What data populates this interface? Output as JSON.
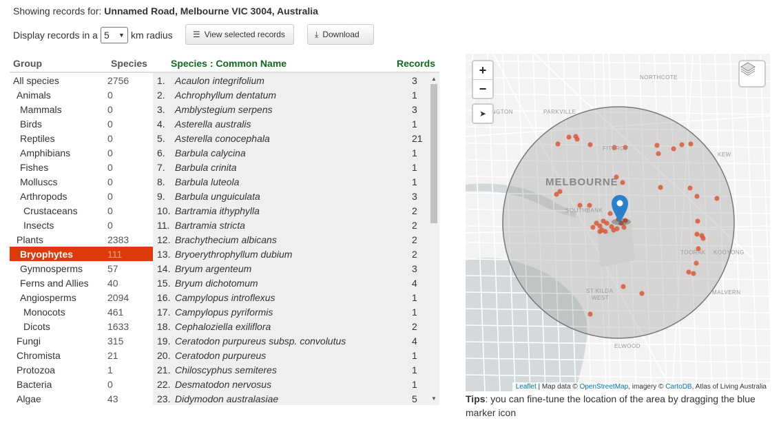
{
  "header": {
    "showing_label": "Showing records for:",
    "address": "Unnamed Road, Melbourne VIC 3004, Australia"
  },
  "radius": {
    "label_before": "Display records in a",
    "value": "5",
    "label_after": "km radius"
  },
  "buttons": {
    "view_selected": "View selected records",
    "download": "Download"
  },
  "groups": {
    "header_group": "Group",
    "header_species": "Species",
    "rows": [
      {
        "name": "All species",
        "count": "2756",
        "level": 0
      },
      {
        "name": "Animals",
        "count": "0",
        "level": 1
      },
      {
        "name": "Mammals",
        "count": "0",
        "level": 2
      },
      {
        "name": "Birds",
        "count": "0",
        "level": 2
      },
      {
        "name": "Reptiles",
        "count": "0",
        "level": 2
      },
      {
        "name": "Amphibians",
        "count": "0",
        "level": 2
      },
      {
        "name": "Fishes",
        "count": "0",
        "level": 2
      },
      {
        "name": "Molluscs",
        "count": "0",
        "level": 2
      },
      {
        "name": "Arthropods",
        "count": "0",
        "level": 2
      },
      {
        "name": "Crustaceans",
        "count": "0",
        "level": 3
      },
      {
        "name": "Insects",
        "count": "0",
        "level": 3
      },
      {
        "name": "Plants",
        "count": "2383",
        "level": 1
      },
      {
        "name": "Bryophytes",
        "count": "111",
        "level": 2,
        "selected": true
      },
      {
        "name": "Gymnosperms",
        "count": "57",
        "level": 2
      },
      {
        "name": "Ferns and Allies",
        "count": "40",
        "level": 2
      },
      {
        "name": "Angiosperms",
        "count": "2094",
        "level": 2
      },
      {
        "name": "Monocots",
        "count": "461",
        "level": 3
      },
      {
        "name": "Dicots",
        "count": "1633",
        "level": 3
      },
      {
        "name": "Fungi",
        "count": "315",
        "level": 1
      },
      {
        "name": "Chromista",
        "count": "21",
        "level": 1
      },
      {
        "name": "Protozoa",
        "count": "1",
        "level": 1
      },
      {
        "name": "Bacteria",
        "count": "0",
        "level": 1
      },
      {
        "name": "Algae",
        "count": "43",
        "level": 1
      }
    ]
  },
  "species": {
    "header_name": "Species : Common Name",
    "header_records": "Records",
    "rows": [
      {
        "num": "1.",
        "name": "Acaulon integrifolium",
        "records": "3"
      },
      {
        "num": "2.",
        "name": "Achrophyllum dentatum",
        "records": "1"
      },
      {
        "num": "3.",
        "name": "Amblystegium serpens",
        "records": "3"
      },
      {
        "num": "4.",
        "name": "Asterella australis",
        "records": "1"
      },
      {
        "num": "5.",
        "name": "Asterella conocephala",
        "records": "21"
      },
      {
        "num": "6.",
        "name": "Barbula calycina",
        "records": "1"
      },
      {
        "num": "7.",
        "name": "Barbula crinita",
        "records": "1"
      },
      {
        "num": "8.",
        "name": "Barbula luteola",
        "records": "1"
      },
      {
        "num": "9.",
        "name": "Barbula unguiculata",
        "records": "3"
      },
      {
        "num": "10.",
        "name": "Bartramia ithyphylla",
        "records": "2"
      },
      {
        "num": "11.",
        "name": "Bartramia stricta",
        "records": "2"
      },
      {
        "num": "12.",
        "name": "Brachythecium albicans",
        "records": "2"
      },
      {
        "num": "13.",
        "name": "Bryoerythrophyllum dubium",
        "records": "2"
      },
      {
        "num": "14.",
        "name": "Bryum argenteum",
        "records": "3"
      },
      {
        "num": "15.",
        "name": "Bryum dichotomum",
        "records": "4"
      },
      {
        "num": "16.",
        "name": "Campylopus introflexus",
        "records": "1"
      },
      {
        "num": "17.",
        "name": "Campylopus pyriformis",
        "records": "1"
      },
      {
        "num": "18.",
        "name": "Cephaloziella exiliflora",
        "records": "2"
      },
      {
        "num": "19.",
        "name": "Ceratodon purpureus subsp. convolutus",
        "records": "4"
      },
      {
        "num": "20.",
        "name": "Ceratodon purpureus",
        "records": "1"
      },
      {
        "num": "21.",
        "name": "Chiloscyphus semiteres",
        "records": "1"
      },
      {
        "num": "22.",
        "name": "Desmatodon nervosus",
        "records": "1"
      },
      {
        "num": "23.",
        "name": "Didymodon australasiae",
        "records": "5"
      }
    ]
  },
  "map": {
    "zoom_in": "+",
    "zoom_out": "−",
    "places": {
      "melbourne": "MELBOURNE",
      "northcote": "NORTHCOTE",
      "parkville": "PARKVILLE",
      "flemington": "INGTON",
      "fitzroy": "FITZROY",
      "kew": "KEW",
      "southbank": "SOUTHBANK",
      "toorak": "TOORAK",
      "kooyong": "KOOYONG",
      "stkilda": "ST KILDA",
      "stkildawest": "WEST",
      "malvern": "MALVERN",
      "elwood": "ELWOOD"
    },
    "attribution": {
      "leaflet": "Leaflet",
      "sep1": " | Map data © ",
      "osm": "OpenStreetMap",
      "sep2": ", imagery © ",
      "carto": "CartoDB",
      "sep3": ", Atlas of Living Australia"
    },
    "colors": {
      "water": "#d4dadc",
      "land": "#f4f3f1",
      "radius_fill": "#9a9a9a",
      "record_dot": "#d9583b",
      "marker": "#2a81cb"
    }
  },
  "tips": {
    "label": "Tips",
    "text": ": you can fine-tune the location of the area by dragging the blue marker icon"
  }
}
